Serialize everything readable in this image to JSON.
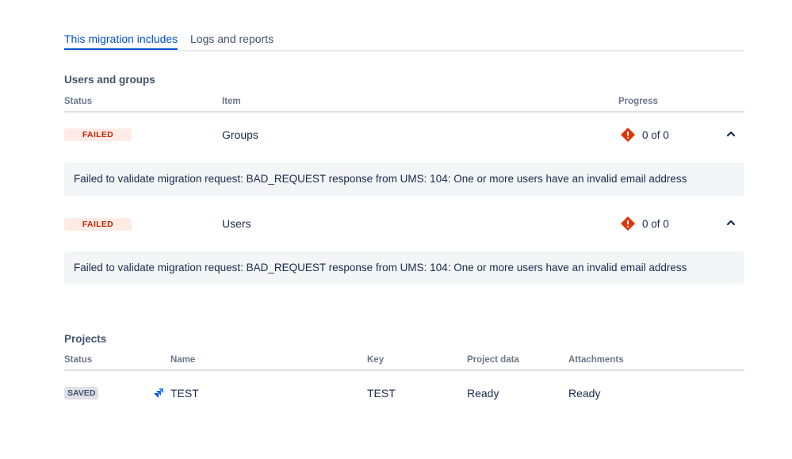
{
  "tabs": [
    {
      "label": "This migration includes",
      "active": true
    },
    {
      "label": "Logs and reports",
      "active": false
    }
  ],
  "users_groups": {
    "title": "Users and groups",
    "headers": {
      "status": "Status",
      "item": "Item",
      "progress": "Progress"
    },
    "rows": [
      {
        "status": "FAILED",
        "item": "Groups",
        "progress": "0 of 0",
        "error": "Failed to validate migration request: BAD_REQUEST response from UMS: 104: One or more users have an invalid email address"
      },
      {
        "status": "FAILED",
        "item": "Users",
        "progress": "0 of 0",
        "error": "Failed to validate migration request: BAD_REQUEST response from UMS: 104: One or more users have an invalid email address"
      }
    ]
  },
  "projects": {
    "title": "Projects",
    "headers": {
      "status": "Status",
      "name": "Name",
      "key": "Key",
      "project_data": "Project data",
      "attachments": "Attachments"
    },
    "rows": [
      {
        "status": "SAVED",
        "name": "TEST",
        "key": "TEST",
        "project_data": "Ready",
        "attachments": "Ready"
      }
    ]
  },
  "colors": {
    "accent": "#0052cc",
    "failed_bg": "#ffebe6",
    "failed_text": "#bf2600",
    "error_icon": "#de350b",
    "saved_bg": "#dfe1e6"
  },
  "icons": {
    "progress_status": "error-icon",
    "expand_toggle": "chevron-up-icon",
    "project_type": "jira-software-icon"
  }
}
